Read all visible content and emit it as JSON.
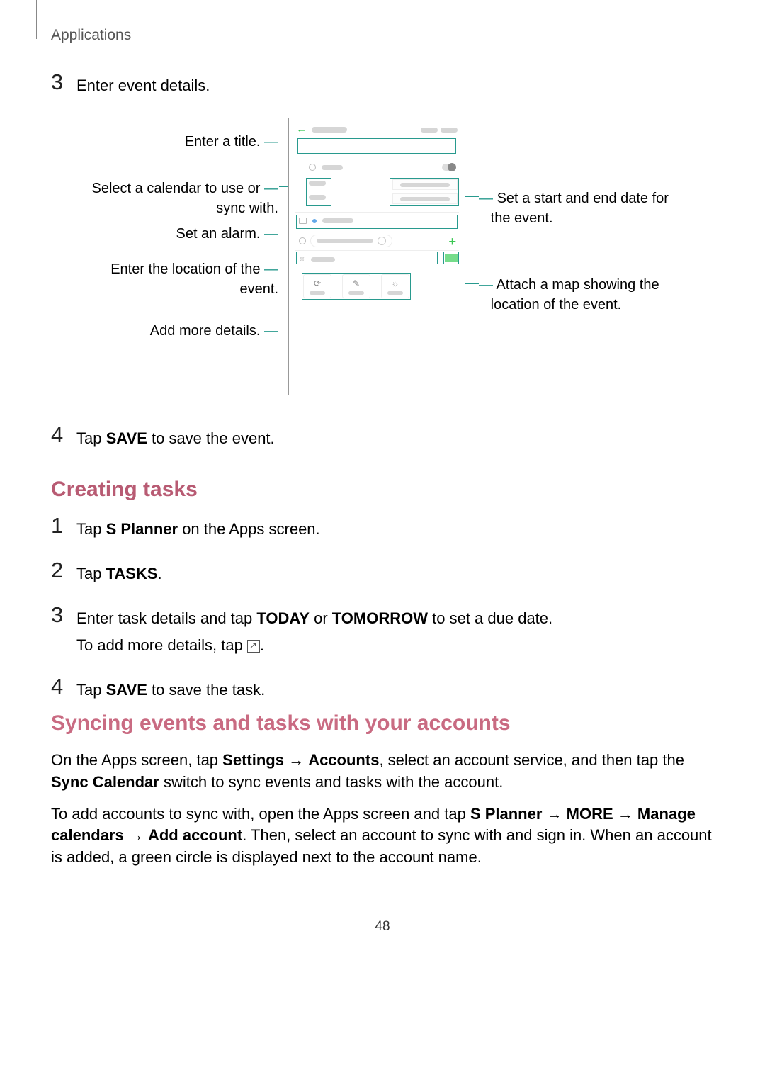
{
  "header": {
    "section": "Applications"
  },
  "page_number": "48",
  "steps_a": {
    "s3": {
      "num": "3",
      "text": "Enter event details."
    },
    "s4": {
      "num": "4",
      "pre": "Tap ",
      "bold": "SAVE",
      "post": " to save the event."
    }
  },
  "heading1": "Creating tasks",
  "steps_b": {
    "s1": {
      "num": "1",
      "pre": "Tap ",
      "bold": "S Planner",
      "post": " on the Apps screen."
    },
    "s2": {
      "num": "2",
      "pre": "Tap ",
      "bold": "TASKS",
      "post": "."
    },
    "s3": {
      "num": "3",
      "line1_pre": "Enter task details and tap ",
      "line1_b1": "TODAY",
      "line1_mid": " or ",
      "line1_b2": "TOMORROW",
      "line1_post": " to set a due date.",
      "line2_pre": "To add more details, tap ",
      "line2_post": "."
    },
    "s4": {
      "num": "4",
      "pre": "Tap ",
      "bold": "SAVE",
      "post": " to save the task."
    }
  },
  "heading2": "Syncing events and tasks with your accounts",
  "para1": {
    "t1": "On the Apps screen, tap ",
    "b1": "Settings",
    "arrow1": " → ",
    "b2": "Accounts",
    "t2": ", select an account service, and then tap the ",
    "b3": "Sync Calendar",
    "t3": " switch to sync events and tasks with the account."
  },
  "para2": {
    "t1": "To add accounts to sync with, open the Apps screen and tap ",
    "b1": "S Planner",
    "arrow1": " → ",
    "b2": "MORE",
    "arrow2": " → ",
    "b3": "Manage calendars",
    "arrow3": " → ",
    "b4": "Add account",
    "t2": ". Then, select an account to sync with and sign in. When an account is added, a green circle is displayed next to the account name."
  },
  "callouts": {
    "left": {
      "title": "Enter a title.",
      "calendar_l1": "Select a calendar to use or",
      "calendar_l2": "sync with.",
      "alarm": "Set an alarm.",
      "location_l1": "Enter the location of the",
      "location_l2": "event.",
      "details": "Add more details."
    },
    "right": {
      "date_l1": "Set a start and end date for",
      "date_l2": "the event.",
      "map_l1": "Attach a map showing the",
      "map_l2": "location of the event."
    }
  }
}
